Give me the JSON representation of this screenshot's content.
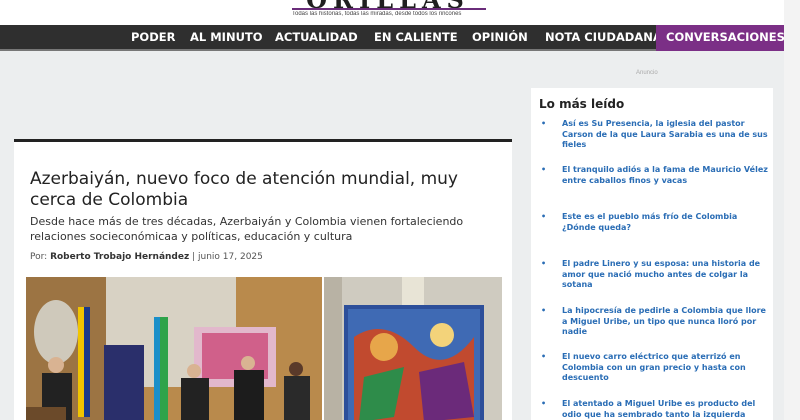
{
  "header": {
    "logo_text": "ORILLAS",
    "tagline": "Todas las historias, todas las miradas, desde todos los rincones"
  },
  "nav": {
    "items": [
      "PODER",
      "AL MINUTO",
      "ACTUALIDAD",
      "EN CALIENTE",
      "OPINIÓN",
      "NOTA CIUDADANA",
      "CONVERSACIONES"
    ],
    "active_index": 6,
    "active_color": "#7b2f86"
  },
  "ad_label": "Anuncio",
  "article": {
    "headline": "Azerbaiyán, nuevo foco de atención mundial, muy cerca de Colombia",
    "summary": "Desde hace más de tres décadas, Azerbaiyán y Colombia vienen fortaleciendo relaciones socieconómicaa y políticas, educación y cultura",
    "byline_prefix": "Por:",
    "author": "Roberto Trobajo Hernández",
    "separator": "|",
    "date": "junio 17, 2025"
  },
  "sidebar": {
    "title": "Lo más leído",
    "items": [
      "Así es Su Presencia, la iglesia del pastor Carson de la que Laura Sarabia es una de sus fieles",
      "El tranquilo adiós a la fama de Mauricio Vélez entre caballos finos y vacas",
      "Este es el pueblo más frío de Colombia ¿Dónde queda?",
      "El padre Linero y su esposa: una historia de amor que nació mucho antes de colgar la sotana",
      "La hipocresía de pedirle a Colombia que llore a Miguel Uribe, un tipo que nunca lloró por nadie",
      "El nuevo carro eléctrico que aterrizó en Colombia con un gran precio y hasta con descuento",
      "El atentado a Miguel Uribe es producto del odio que ha sembrado tanto la izquierda como la derecha"
    ]
  }
}
